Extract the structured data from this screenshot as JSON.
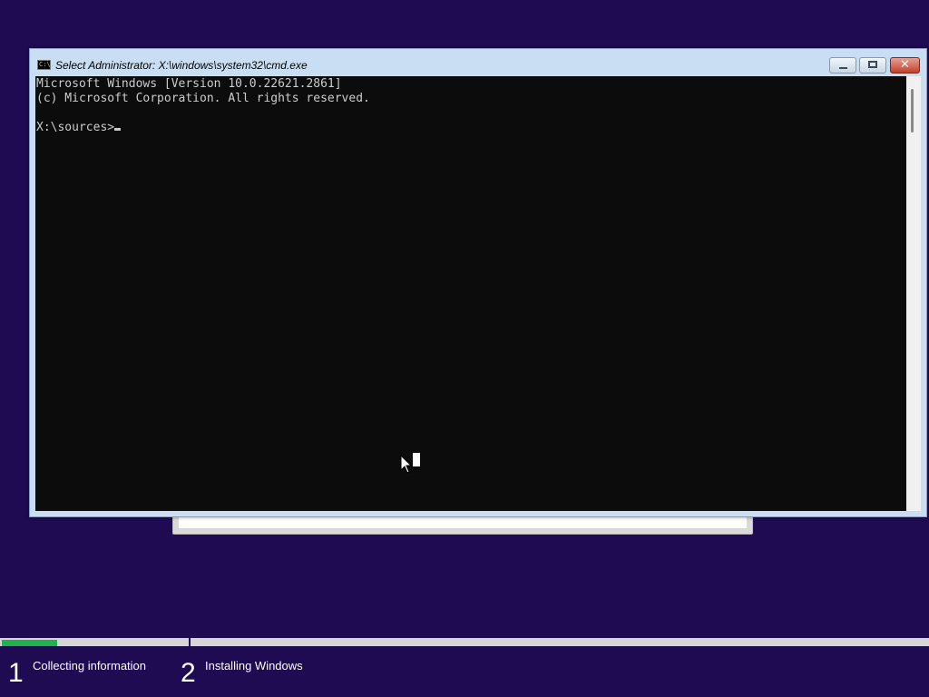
{
  "window": {
    "title": "Select Administrator: X:\\windows\\system32\\cmd.exe",
    "icon": "cmd-icon",
    "icon_text": "C:\\.",
    "controls": {
      "minimize_icon": "minimize-icon",
      "maximize_icon": "restore-icon",
      "close_label": "✕"
    }
  },
  "console": {
    "lines": [
      "Microsoft Windows [Version 10.0.22621.2861]",
      "(c) Microsoft Corporation. All rights reserved.",
      "",
      "X:\\sources>"
    ]
  },
  "setup": {
    "progress_fraction": 0.06,
    "steps": [
      {
        "number": "1",
        "label": "Collecting information"
      },
      {
        "number": "2",
        "label": "Installing Windows"
      }
    ]
  },
  "colors": {
    "desktop_bg": "#1e0b52",
    "console_bg": "#0c0c0c",
    "console_text": "#cccccc",
    "progress": "#22b14c"
  }
}
